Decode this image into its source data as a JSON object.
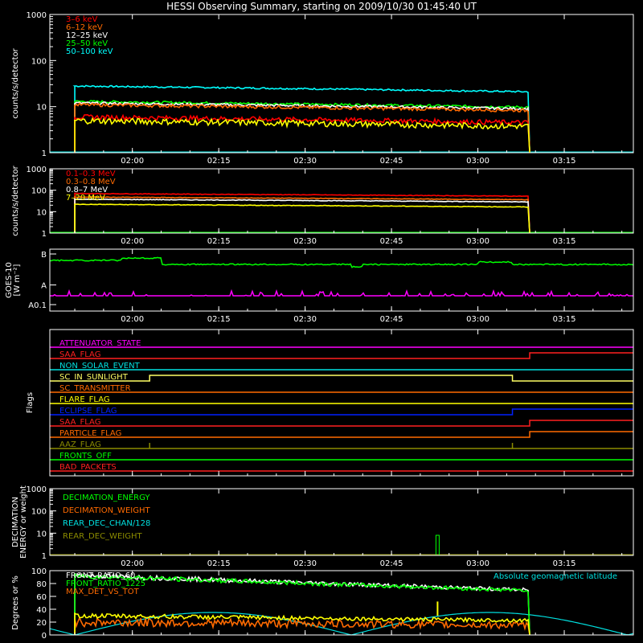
{
  "title": "HESSI Observing Summary, starting on 2009/10/30 01:45:40 UT",
  "time_ticks": [
    "02:00",
    "02:15",
    "02:30",
    "02:45",
    "03:00",
    "03:15"
  ],
  "chart_data": [
    {
      "id": "low-energy",
      "type": "line",
      "ylabel": "counts/s/detector",
      "yscale": "log",
      "ylim": [
        1,
        1000
      ],
      "yticks": [
        "1",
        "10",
        "100",
        "1000"
      ],
      "x_range": [
        "01:45:40",
        "03:27"
      ],
      "series": [
        {
          "name": "3–6 keV",
          "color": "#ff0000",
          "level": 6,
          "noise": 0.12
        },
        {
          "name": "6–12 keV",
          "color": "#ff6a00",
          "level": 11,
          "noise": 0.08
        },
        {
          "name": "12–25 keV",
          "color": "#ffffff",
          "level": 12,
          "noise": 0.06
        },
        {
          "name": "25–50 keV",
          "color": "#00ff00",
          "level": 13,
          "noise": 0.06
        },
        {
          "name": "50–100 keV",
          "color": "#00ffff",
          "level": 28,
          "noise": 0.04
        }
      ],
      "extra_series": [
        {
          "color": "#ffff00",
          "level": 5,
          "noise": 0.15
        }
      ],
      "active": [
        "01:50",
        "03:09"
      ]
    },
    {
      "id": "high-energy",
      "type": "line",
      "ylabel": "counts/s/detector",
      "yscale": "log",
      "ylim": [
        1,
        1000
      ],
      "yticks": [
        "1",
        "10",
        "100",
        "1000"
      ],
      "series": [
        {
          "name": "0.1–0.3 MeV",
          "color": "#ff0000",
          "level": 70,
          "noise": 0.03
        },
        {
          "name": "0.3–0.8 MeV",
          "color": "#ff6a00",
          "level": 48,
          "noise": 0.03
        },
        {
          "name": "0.8–7 MeV",
          "color": "#ffffff",
          "level": 38,
          "noise": 0.03
        },
        {
          "name": "7–20 MeV",
          "color": "#ffff00",
          "level": 22,
          "noise": 0.03
        }
      ],
      "active": [
        "01:50",
        "03:09"
      ]
    },
    {
      "id": "goes",
      "type": "line",
      "ylabel": "GOES-10",
      "yunit": "[W m⁻²]",
      "yticks": [
        "A0.1",
        "A",
        "B"
      ],
      "series": [
        {
          "color": "#00ff00",
          "class_level": 0.8
        },
        {
          "color": "#ff00ff",
          "class_level": 0.08
        }
      ]
    },
    {
      "id": "flags",
      "type": "timeline",
      "ylabel": "Flags",
      "flags": [
        {
          "name": "ATTENUATOR_STATE",
          "color": "#ff00ff",
          "steps": []
        },
        {
          "name": "SAA_FLAG",
          "color": "#ff2020",
          "steps": [
            [
              "03:09",
              1
            ]
          ]
        },
        {
          "name": "NON_SOLAR_EVENT",
          "color": "#00e0e0",
          "steps": []
        },
        {
          "name": "SC_IN_SUNLIGHT",
          "color": "#ffff66",
          "steps": [
            [
              "02:03",
              1
            ],
            [
              "03:06",
              0
            ]
          ]
        },
        {
          "name": "SC_TRANSMITTER",
          "color": "#ff6a00",
          "steps": []
        },
        {
          "name": "FLARE_FLAG",
          "color": "#ffff00",
          "steps": []
        },
        {
          "name": "ECLIPSE_FLAG",
          "color": "#0020ff",
          "steps": [
            [
              "02:03",
              0
            ],
            [
              "03:06",
              1
            ]
          ]
        },
        {
          "name": "SAA_FLAG",
          "color": "#ff2020",
          "steps": [
            [
              "03:09",
              1
            ]
          ]
        },
        {
          "name": "PARTICLE_FLAG",
          "color": "#ff6a00",
          "steps": [
            [
              "03:09",
              1
            ]
          ]
        },
        {
          "name": "AAZ_FLAG",
          "color": "#8c8c00",
          "steps": [
            [
              "02:03",
              1
            ],
            [
              "02:03",
              0
            ],
            [
              "03:06",
              1
            ],
            [
              "03:06",
              0
            ]
          ]
        },
        {
          "name": "FRONTS_OFF",
          "color": "#00ff00",
          "steps": []
        },
        {
          "name": "BAD_PACKETS",
          "color": "#ff2020",
          "steps": []
        }
      ]
    },
    {
      "id": "decimation",
      "type": "line",
      "ylabel": "DECIMATION",
      "ylabel2": "ENERGY or weight",
      "yscale": "log",
      "ylim": [
        1,
        1000
      ],
      "yticks": [
        "1",
        "10",
        "100",
        "1000"
      ],
      "series": [
        {
          "name": "DECIMATION_ENERGY",
          "color": "#00ff00"
        },
        {
          "name": "DECIMATION_WEIGHT",
          "color": "#ff6a00"
        },
        {
          "name": "REAR_DEC_CHAN/128",
          "color": "#00e0e0"
        },
        {
          "name": "REAR_DEC_WEIGHT",
          "color": "#8c8c00"
        }
      ],
      "spike": {
        "time": "02:53",
        "value": 8
      }
    },
    {
      "id": "ratios",
      "type": "line",
      "ylabel": "Degrees or %",
      "ylim": [
        0,
        100
      ],
      "yticks": [
        "0",
        "20",
        "40",
        "60",
        "80",
        "100"
      ],
      "series": [
        {
          "name": "FRONT_RATIO_60",
          "color": "#ffffff",
          "level": 93
        },
        {
          "name": "FRONT_RATIO_1225",
          "color": "#00ff00",
          "level": 92
        },
        {
          "name": "MAX_DET_VS_TOT",
          "color": "#ff6a00",
          "level": 20
        }
      ],
      "extra_series": [
        {
          "color": "#ffff00",
          "level": 30
        }
      ],
      "annotation": "Absolute geomagnetic latitude",
      "annotation_color": "#00e0e0"
    }
  ]
}
